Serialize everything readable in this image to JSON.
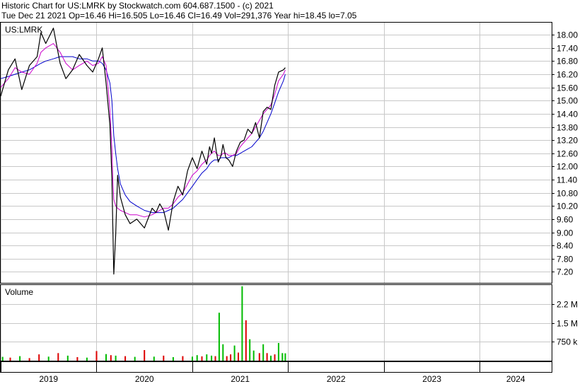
{
  "header": {
    "line1": "Historic Chart for US:LMRK by Stockwatch.com 604.687.1500 - (c) 2021",
    "line2": "Tue Dec 21 2021   Op=16.46   Hi=16.505   Lo=16.46   Cl=16.49   Vol=291,376   Year hi=18.45   lo=7.05"
  },
  "chart_data": [
    {
      "type": "line",
      "title": "US:LMRK",
      "ylim": [
        6.7,
        18.55
      ],
      "grid": true,
      "y_ticks": [
        "18.00",
        "17.40",
        "16.80",
        "16.20",
        "15.60",
        "15.00",
        "14.40",
        "13.80",
        "13.20",
        "12.60",
        "12.00",
        "11.40",
        "10.80",
        "10.20",
        "9.60",
        "9.00",
        "8.40",
        "7.80",
        "7.20"
      ],
      "x": [
        2019.0,
        2019.08,
        2019.15,
        2019.22,
        2019.3,
        2019.38,
        2019.42,
        2019.47,
        2019.55,
        2019.62,
        2019.68,
        2019.75,
        2019.82,
        2019.9,
        2019.96,
        2020.02,
        2020.06,
        2020.1,
        2020.14,
        2020.16,
        2020.17,
        2020.18,
        2020.2,
        2020.22,
        2020.25,
        2020.3,
        2020.35,
        2020.42,
        2020.5,
        2020.58,
        2020.62,
        2020.66,
        2020.7,
        2020.75,
        2020.8,
        2020.85,
        2020.9,
        2020.95,
        2021.0,
        2021.05,
        2021.1,
        2021.15,
        2021.18,
        2021.2,
        2021.23,
        2021.25,
        2021.27,
        2021.3,
        2021.32,
        2021.35,
        2021.38,
        2021.42,
        2021.46,
        2021.5,
        2021.54,
        2021.58,
        2021.62,
        2021.66,
        2021.7,
        2021.74,
        2021.78,
        2021.82,
        2021.86,
        2021.9,
        2021.95,
        2021.97
      ],
      "series": [
        {
          "role": "price",
          "color": "#000000",
          "values": [
            15.2,
            16.4,
            16.9,
            15.5,
            16.6,
            17.0,
            18.1,
            17.6,
            18.3,
            16.7,
            16.0,
            16.4,
            17.1,
            16.6,
            16.3,
            16.9,
            17.4,
            15.8,
            13.9,
            11.5,
            9.3,
            7.1,
            8.9,
            11.6,
            10.6,
            9.8,
            9.4,
            9.6,
            9.2,
            10.1,
            9.9,
            10.3,
            10.0,
            9.1,
            10.4,
            11.1,
            10.7,
            11.8,
            12.4,
            11.9,
            12.7,
            12.1,
            12.9,
            12.6,
            13.3,
            12.7,
            12.2,
            12.5,
            13.0,
            12.4,
            12.3,
            12.0,
            12.7,
            13.1,
            13.2,
            13.7,
            13.5,
            14.0,
            13.3,
            14.5,
            14.7,
            14.6,
            15.7,
            16.3,
            16.4,
            16.5
          ]
        },
        {
          "role": "ma_short",
          "color": "#cc00cc",
          "values": [
            15.6,
            16.0,
            16.5,
            16.3,
            16.2,
            16.7,
            17.2,
            17.4,
            17.6,
            17.2,
            16.7,
            16.4,
            16.6,
            16.8,
            16.6,
            16.7,
            17.0,
            16.6,
            14.6,
            12.8,
            11.4,
            10.5,
            10.2,
            10.1,
            10.0,
            9.9,
            9.8,
            9.8,
            9.7,
            9.8,
            9.9,
            10.0,
            10.1,
            10.1,
            10.3,
            10.6,
            10.8,
            11.2,
            11.6,
            11.8,
            12.1,
            12.3,
            12.5,
            12.6,
            12.7,
            12.6,
            12.5,
            12.5,
            12.6,
            12.6,
            12.5,
            12.5,
            12.6,
            12.9,
            13.1,
            13.3,
            13.5,
            13.8,
            14.1,
            14.4,
            14.6,
            14.8,
            15.3,
            15.9,
            16.2,
            16.4
          ]
        },
        {
          "role": "ma_long",
          "color": "#0000cc",
          "values": [
            16.0,
            16.1,
            16.2,
            16.3,
            16.4,
            16.6,
            16.7,
            16.8,
            16.9,
            17.0,
            17.0,
            17.0,
            16.9,
            16.9,
            16.8,
            16.8,
            16.7,
            16.4,
            15.8,
            15.0,
            14.2,
            13.4,
            12.6,
            11.9,
            11.2,
            10.7,
            10.4,
            10.2,
            10.0,
            9.9,
            9.9,
            9.9,
            9.9,
            10.0,
            10.1,
            10.3,
            10.5,
            10.8,
            11.1,
            11.4,
            11.7,
            11.9,
            12.1,
            12.2,
            12.3,
            12.3,
            12.3,
            12.4,
            12.4,
            12.4,
            12.4,
            12.5,
            12.5,
            12.6,
            12.7,
            12.8,
            12.9,
            13.1,
            13.3,
            13.6,
            14.0,
            14.4,
            14.9,
            15.4,
            15.9,
            16.2
          ]
        }
      ]
    },
    {
      "type": "bar",
      "title": "Volume",
      "ylim": [
        0,
        3000000
      ],
      "grid": true,
      "y_ticks": [
        "2.2 M",
        "1.5 M",
        "750 k"
      ],
      "y_tick_values": [
        2250000,
        1500000,
        750000
      ],
      "colors": {
        "up": "#00bb00",
        "down": "#dd0000"
      },
      "x": [
        2019.02,
        2019.1,
        2019.2,
        2019.3,
        2019.4,
        2019.5,
        2019.6,
        2019.7,
        2019.8,
        2019.9,
        2020.0,
        2020.1,
        2020.15,
        2020.2,
        2020.3,
        2020.4,
        2020.5,
        2020.6,
        2020.7,
        2020.8,
        2020.9,
        2021.0,
        2021.05,
        2021.1,
        2021.15,
        2021.2,
        2021.24,
        2021.28,
        2021.32,
        2021.36,
        2021.4,
        2021.44,
        2021.48,
        2021.52,
        2021.56,
        2021.6,
        2021.64,
        2021.7,
        2021.74,
        2021.78,
        2021.82,
        2021.86,
        2021.9,
        2021.94,
        2021.97
      ],
      "values": [
        150000,
        120000,
        180000,
        100000,
        250000,
        160000,
        300000,
        200000,
        140000,
        120000,
        380000,
        260000,
        220000,
        200000,
        180000,
        150000,
        420000,
        160000,
        200000,
        140000,
        180000,
        160000,
        220000,
        170000,
        250000,
        200000,
        180000,
        1900000,
        650000,
        180000,
        250000,
        600000,
        320000,
        2950000,
        1600000,
        850000,
        400000,
        300000,
        650000,
        300000,
        200000,
        250000,
        700000,
        300000,
        291376
      ],
      "up": [
        true,
        false,
        true,
        false,
        false,
        true,
        false,
        true,
        false,
        true,
        false,
        true,
        false,
        true,
        false,
        true,
        false,
        true,
        false,
        true,
        false,
        true,
        true,
        false,
        true,
        true,
        false,
        true,
        true,
        false,
        false,
        true,
        false,
        true,
        false,
        true,
        true,
        false,
        true,
        false,
        true,
        false,
        true,
        true,
        true
      ]
    }
  ],
  "x_axis": {
    "labels": [
      "2019",
      "2020",
      "2021",
      "2022",
      "2023",
      "2024"
    ],
    "range": [
      2019.0,
      2024.75
    ]
  }
}
